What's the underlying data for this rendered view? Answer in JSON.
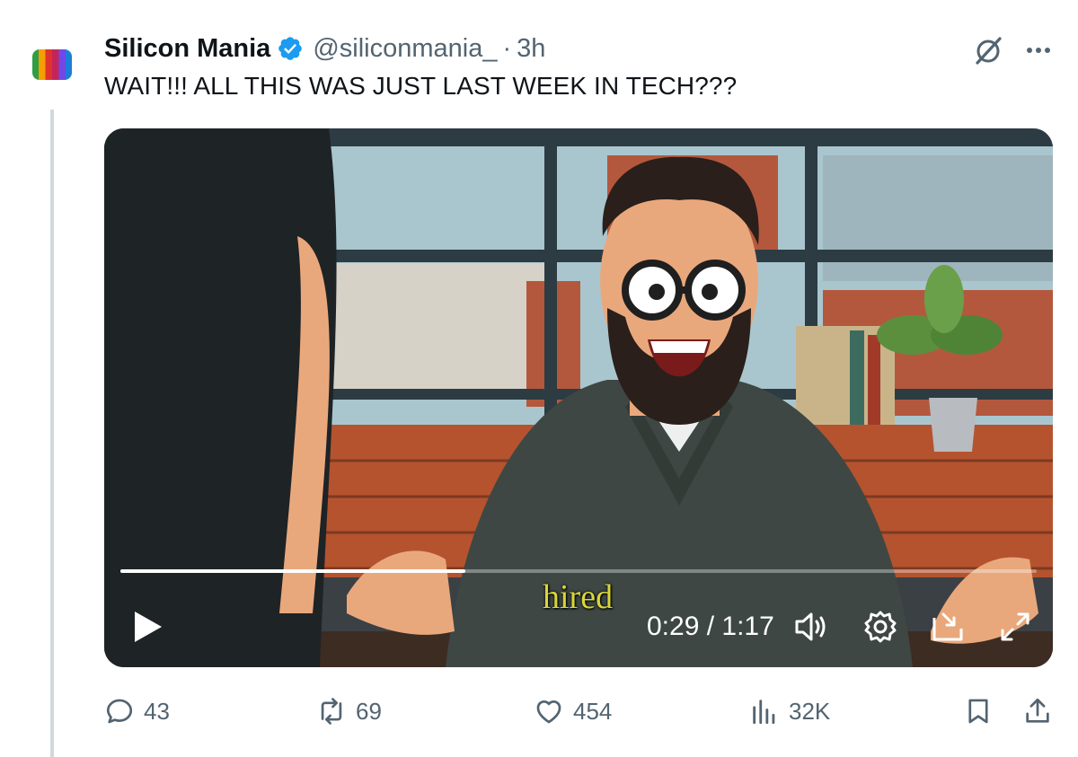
{
  "tweet": {
    "author": {
      "display_name": "Silicon Mania",
      "handle": "@siliconmania_",
      "separator": "·",
      "time": "3h"
    },
    "text": "WAIT!!! ALL THIS WAS JUST LAST WEEK IN TECH???",
    "header_icons": [
      "verified-badge-icon",
      "grok-icon",
      "more-icon"
    ]
  },
  "video": {
    "caption": "hired",
    "time_display": "0:29 / 1:17",
    "progress": 0.376,
    "controls": [
      "play-icon",
      "volume-icon",
      "settings-icon",
      "picture-in-picture-icon",
      "fullscreen-icon"
    ]
  },
  "actions": {
    "replies": {
      "icon": "reply-icon",
      "count": "43"
    },
    "reposts": {
      "icon": "repost-icon",
      "count": "69"
    },
    "likes": {
      "icon": "heart-icon",
      "count": "454"
    },
    "views": {
      "icon": "views-icon",
      "count": "32K"
    },
    "bookmark": {
      "icon": "bookmark-icon"
    },
    "share": {
      "icon": "share-icon"
    }
  },
  "colors": {
    "verified": "#1d9bf0",
    "muted_text": "#536471",
    "caption": "#d9d63a"
  }
}
